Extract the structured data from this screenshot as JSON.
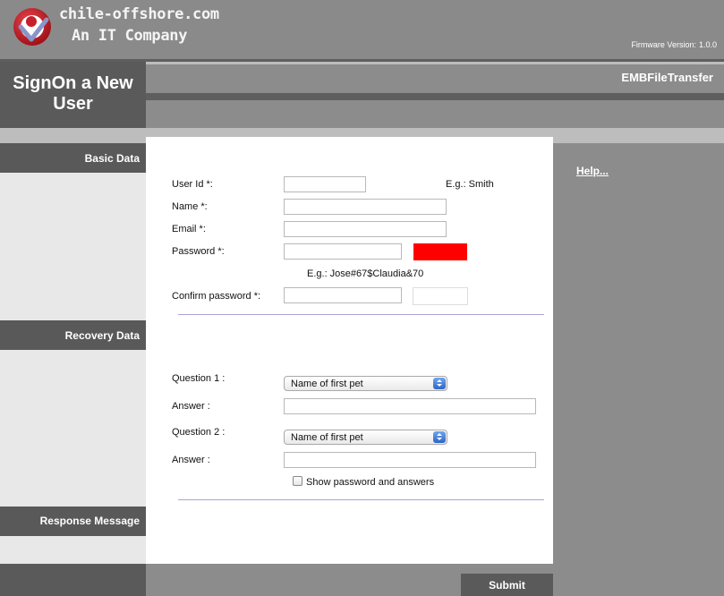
{
  "header": {
    "brand_line1": "chile-offshore.com",
    "brand_line2": "An IT Company",
    "firmware_label": "Firmware Version:",
    "firmware_version": "1.0.0",
    "logo_colors": {
      "outer": "#c8202a",
      "inner": "#ffffff",
      "check": "#8a95c8"
    }
  },
  "title": {
    "page_title": "SignOn a New User",
    "app_name": "EMBFileTransfer"
  },
  "sidebar": {
    "basic_data": "Basic Data",
    "recovery_data": "Recovery Data",
    "response_message": "Response Message"
  },
  "form": {
    "user_id": {
      "label": "User Id *:",
      "value": "",
      "hint": "E.g.: Smith"
    },
    "name": {
      "label": "Name *:",
      "value": ""
    },
    "email": {
      "label": "Email *:",
      "value": ""
    },
    "password": {
      "label": "Password *:",
      "value": "",
      "hint": "E.g.: Jose#67$Claudia&70",
      "strength_color": "#ff0000"
    },
    "confirm_password": {
      "label": "Confirm password *:",
      "value": ""
    },
    "question1": {
      "label": "Question 1 :",
      "selected": "Name of first pet"
    },
    "answer1": {
      "label": "Answer :",
      "value": ""
    },
    "question2": {
      "label": "Question 2 :",
      "selected": "Name of first pet"
    },
    "answer2": {
      "label": "Answer :",
      "value": ""
    },
    "show_password": {
      "label": "Show password and answers",
      "checked": false
    }
  },
  "help_link": "Help...",
  "submit_label": "Submit"
}
